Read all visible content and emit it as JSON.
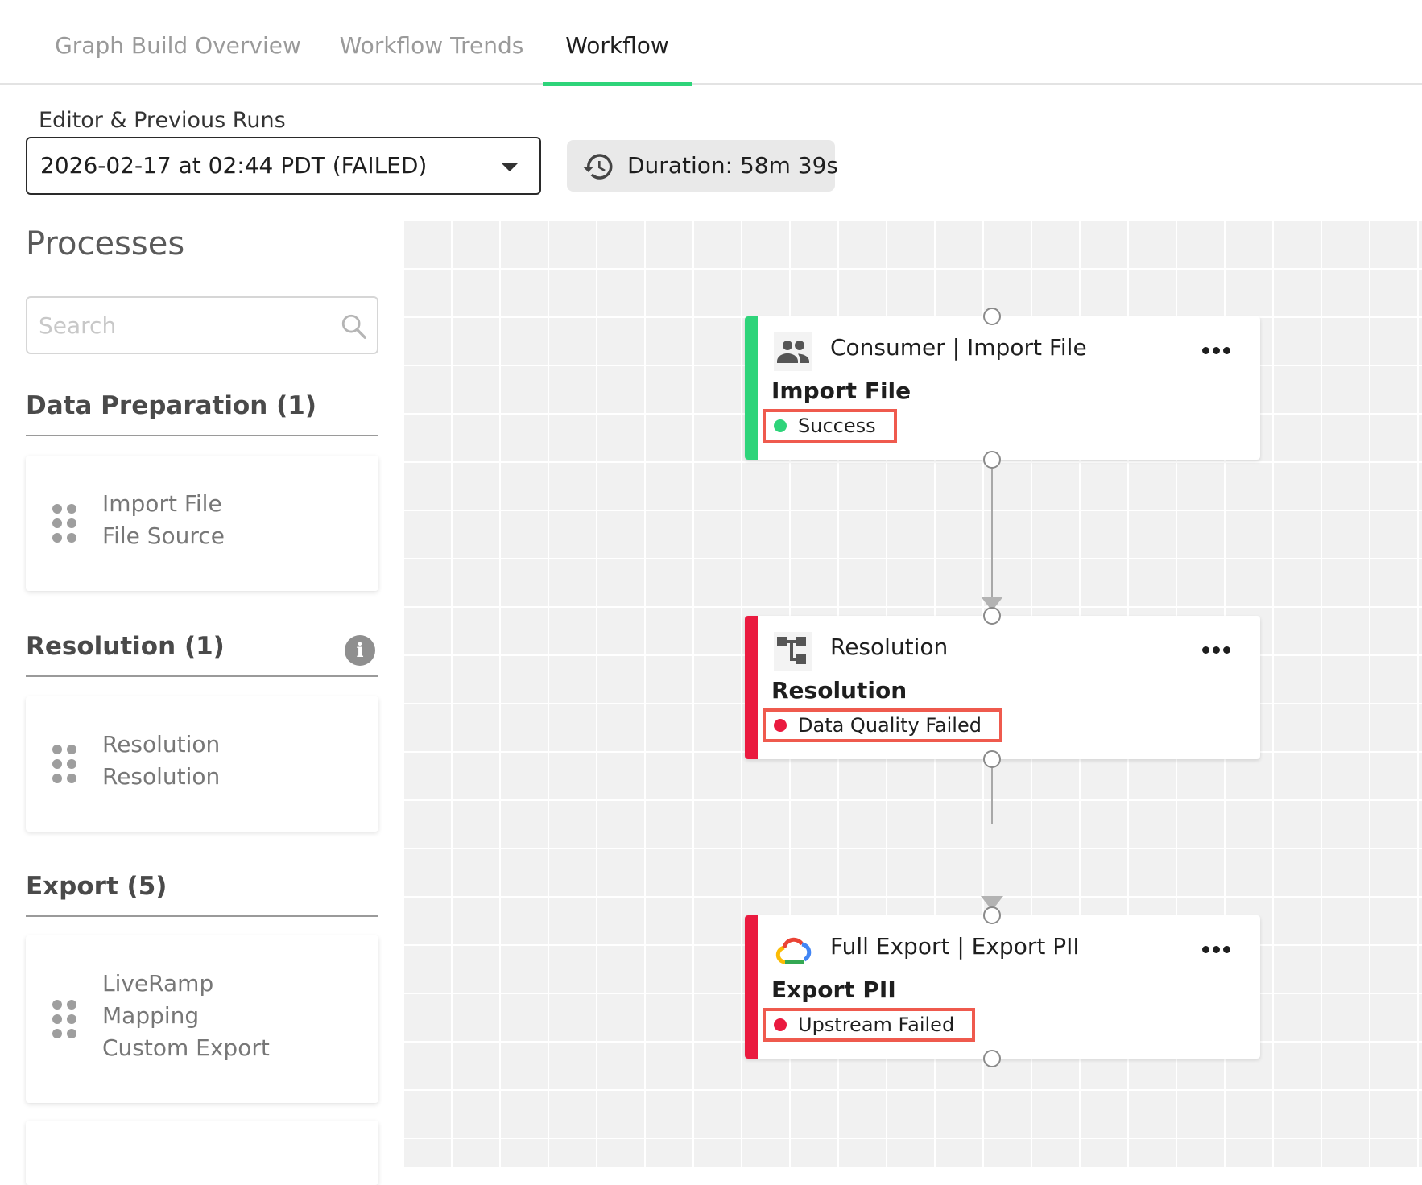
{
  "tabs": [
    {
      "label": "Graph Build Overview",
      "active": false
    },
    {
      "label": "Workflow Trends",
      "active": false
    },
    {
      "label": "Workflow",
      "active": true
    }
  ],
  "run_selector": {
    "label": "Editor & Previous Runs",
    "selected": "2026-02-17 at 02:44 PDT (FAILED)"
  },
  "duration": {
    "text": "Duration: 58m 39s",
    "icon": "history-icon"
  },
  "sidebar": {
    "title": "Processes",
    "search_placeholder": "Search",
    "sections": [
      {
        "title": "Data Preparation (1)",
        "cards": [
          {
            "lines": [
              "Import File",
              "File Source"
            ]
          }
        ]
      },
      {
        "title": "Resolution (1)",
        "info_icon": "info-icon",
        "cards": [
          {
            "lines": [
              "Resolution",
              "Resolution"
            ]
          }
        ]
      },
      {
        "title": "Export (5)",
        "cards": [
          {
            "lines": [
              "LiveRamp",
              "Mapping",
              "Custom Export"
            ]
          }
        ]
      }
    ]
  },
  "workflow": {
    "nodes": [
      {
        "type_label": "Consumer | Import File",
        "name": "Import File",
        "status": "Success",
        "status_color": "#2ed47a",
        "bar_color": "#2ed47a",
        "icon": "consumer-group-icon"
      },
      {
        "type_label": "Resolution",
        "name": "Resolution",
        "status": "Data Quality Failed",
        "status_color": "#ea1a3f",
        "bar_color": "#ea1a3f",
        "icon": "resolution-flow-icon"
      },
      {
        "type_label": "Full Export | Export PII",
        "name": "Export PII",
        "status": "Upstream Failed",
        "status_color": "#ea1a3f",
        "bar_color": "#ea1a3f",
        "icon": "google-cloud-icon"
      }
    ]
  },
  "colors": {
    "accent_green": "#2ed47a",
    "failure_red": "#ea1a3f",
    "highlight_outline": "#ef5a4e"
  }
}
